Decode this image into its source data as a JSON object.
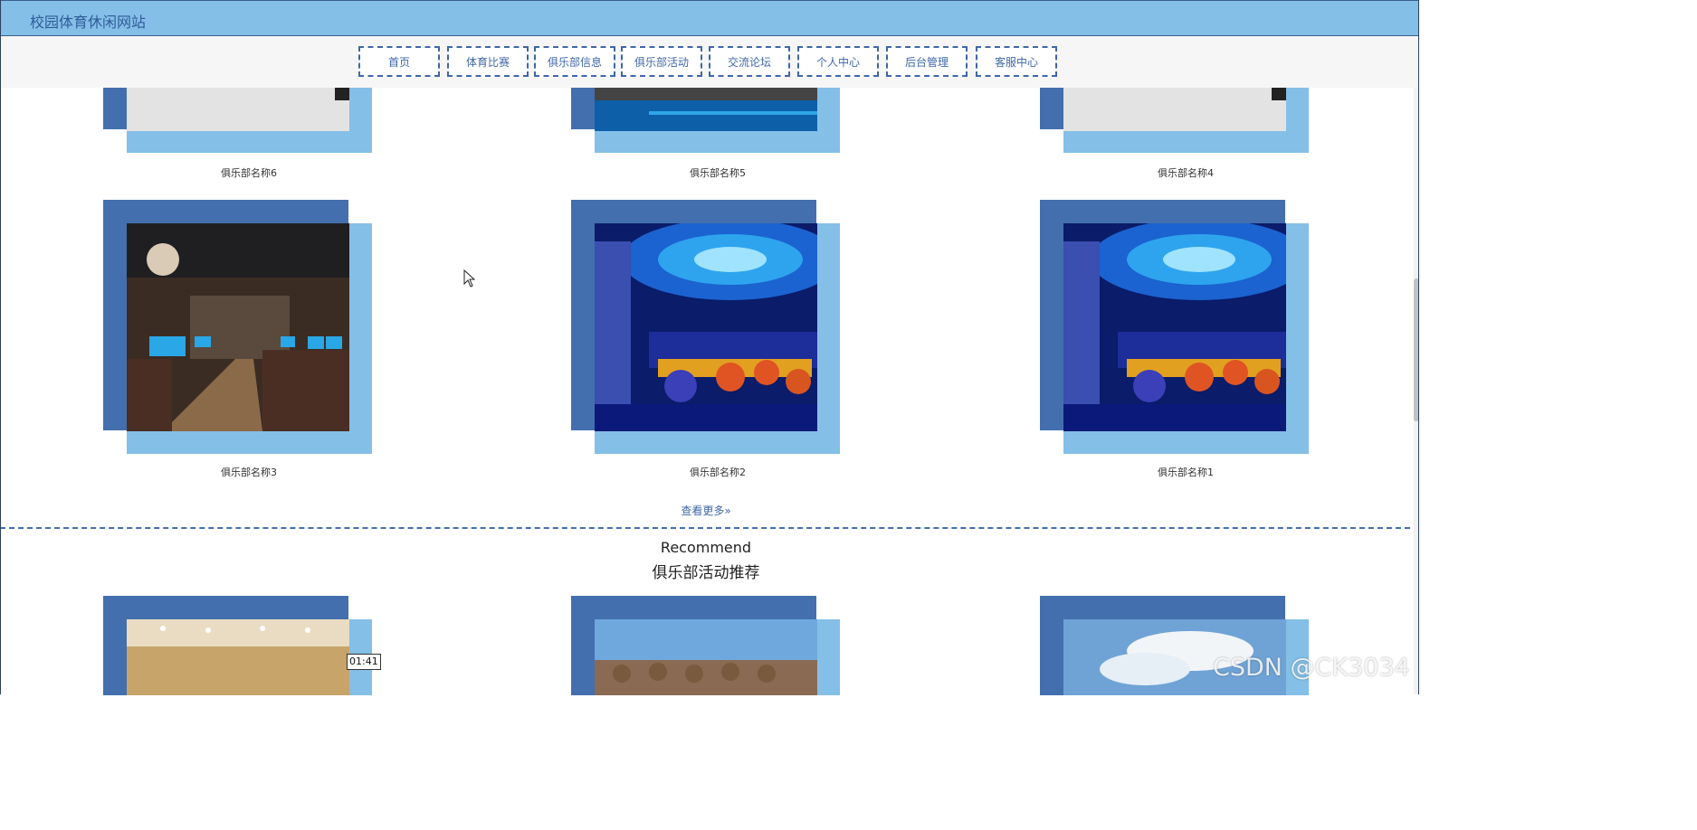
{
  "header": {
    "title": "校园体育休闲网站"
  },
  "nav": {
    "items": [
      {
        "label": "首页"
      },
      {
        "label": "体育比赛"
      },
      {
        "label": "俱乐部信息"
      },
      {
        "label": "俱乐部活动"
      },
      {
        "label": "交流论坛"
      },
      {
        "label": "个人中心"
      },
      {
        "label": "后台管理"
      },
      {
        "label": "客服中心"
      }
    ]
  },
  "clubs": {
    "row1": [
      {
        "name": "俱乐部名称6"
      },
      {
        "name": "俱乐部名称5"
      },
      {
        "name": "俱乐部名称4"
      }
    ],
    "row2": [
      {
        "name": "俱乐部名称3"
      },
      {
        "name": "俱乐部名称2"
      },
      {
        "name": "俱乐部名称1"
      }
    ],
    "more_label": "查看更多»"
  },
  "recommend": {
    "title_en": "Recommend",
    "title_cn": "俱乐部活动推荐"
  },
  "overlay": {
    "video_time": "01:41",
    "watermark": "CSDN @CK3034"
  },
  "colors": {
    "header_bg": "#84bfe7",
    "accent_dark": "#436fae",
    "accent_light": "#84bfe7",
    "nav_text": "#3f67a8"
  }
}
